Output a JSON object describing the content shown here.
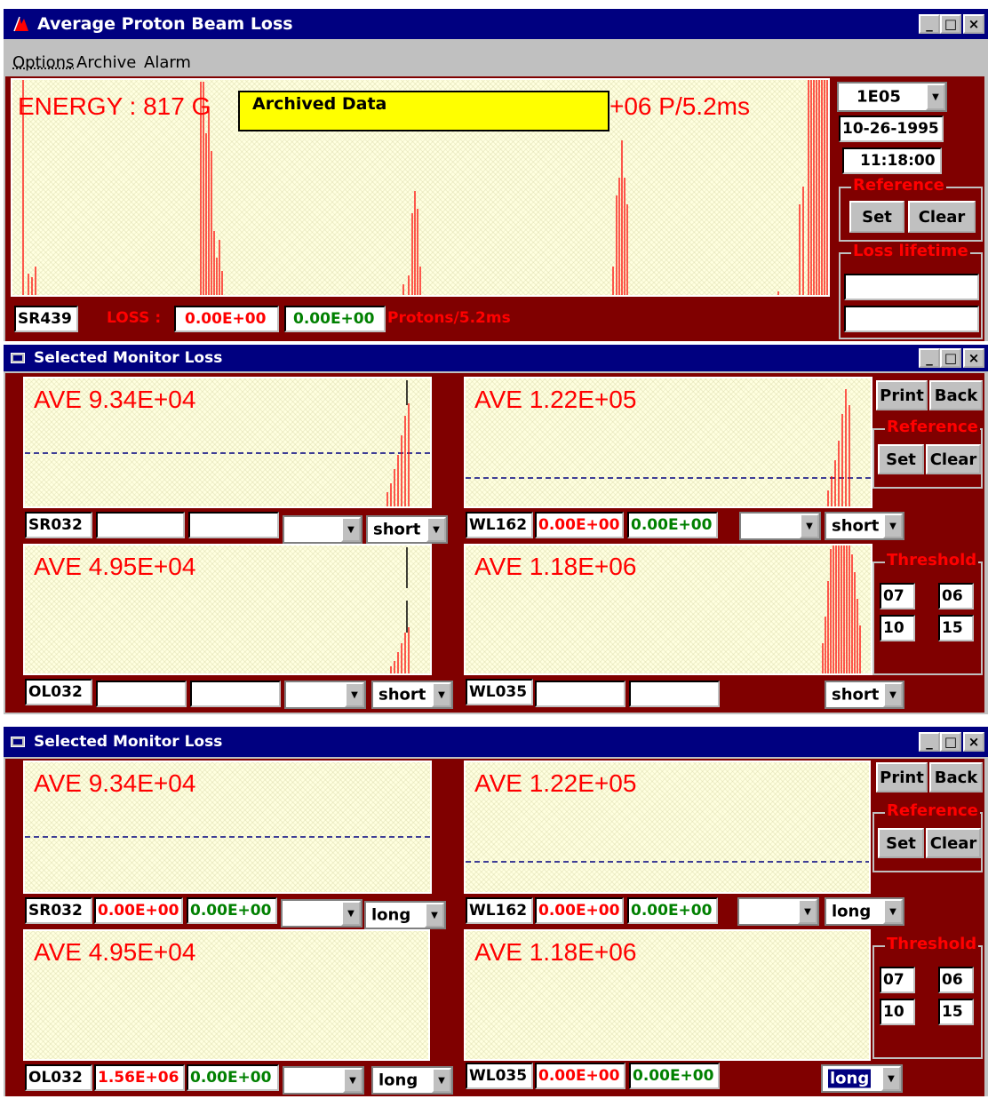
{
  "top_window": {
    "title": "Average Proton Beam Loss",
    "menu": [
      "Options",
      "Archive",
      "Alarm"
    ],
    "energy_text_left": "ENERGY : 817 G",
    "energy_text_right": "+06 P/5.2ms",
    "archived_label": "Archived Data",
    "scale_select": "1E05",
    "date": "10-26-1995",
    "time": "11:18:00",
    "reference_label": "Reference",
    "set_button": "Set",
    "clear_button": "Clear",
    "loss_lifetime_label": "Loss lifetime",
    "monitor": "SR439",
    "loss_label": "LOSS :",
    "loss_value_red": "0.00E+00",
    "loss_value_green": "0.00E+00",
    "units": "Protons/5.2ms"
  },
  "panel1": {
    "title": "Selected Monitor Loss",
    "print_button": "Print",
    "back_button": "Back",
    "reference_label": "Reference",
    "set_button": "Set",
    "clear_button": "Clear",
    "threshold_label": "Threshold",
    "thresholds": [
      "07",
      "06",
      "10",
      "15"
    ],
    "plots": [
      {
        "ave": "AVE 9.34E+04",
        "monitor": "SR032",
        "red": "",
        "green": "",
        "mode": "short"
      },
      {
        "ave": "AVE 1.22E+05",
        "monitor": "WL162",
        "red": "0.00E+00",
        "green": "0.00E+00",
        "mode": "short"
      },
      {
        "ave": "AVE 4.95E+04",
        "monitor": "OL032",
        "red": "",
        "green": "",
        "mode": "short"
      },
      {
        "ave": "AVE 1.18E+06",
        "monitor": "WL035",
        "red": "",
        "green": "",
        "mode": "short"
      }
    ]
  },
  "panel2": {
    "title": "Selected Monitor Loss",
    "print_button": "Print",
    "back_button": "Back",
    "reference_label": "Reference",
    "set_button": "Set",
    "clear_button": "Clear",
    "threshold_label": "Threshold",
    "thresholds": [
      "07",
      "06",
      "10",
      "15"
    ],
    "plots": [
      {
        "ave": "AVE 9.34E+04",
        "monitor": "SR032",
        "red": "0.00E+00",
        "green": "0.00E+00",
        "mode": "long"
      },
      {
        "ave": "AVE 1.22E+05",
        "monitor": "WL162",
        "red": "0.00E+00",
        "green": "0.00E+00",
        "mode": "long"
      },
      {
        "ave": "AVE 4.95E+04",
        "monitor": "OL032",
        "red": "1.56E+06",
        "green": "0.00E+00",
        "mode": "long"
      },
      {
        "ave": "AVE 1.18E+06",
        "monitor": "WL035",
        "red": "0.00E+00",
        "green": "0.00E+00",
        "mode": "long"
      }
    ]
  },
  "window_buttons": {
    "minimize": "_",
    "maximize": "□",
    "close": "×"
  },
  "colors": {
    "titlebar": "#000080",
    "panel": "#800000",
    "plot_bg": "#ffffe0",
    "loss_red": "#ff0000",
    "ok_green": "#008000"
  }
}
